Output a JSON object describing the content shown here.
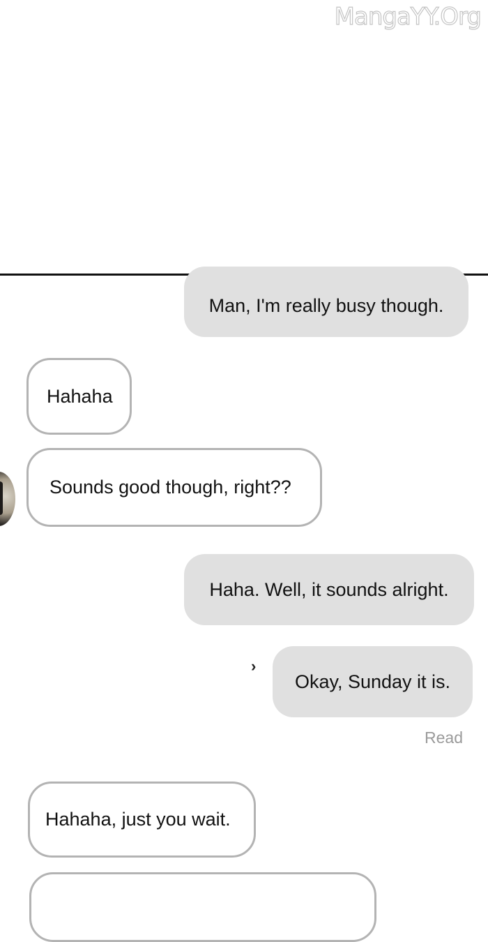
{
  "watermark": "MangaYY.Org",
  "messages": [
    {
      "side": "sent",
      "text": "Man, I'm really busy though."
    },
    {
      "side": "received",
      "text": "Hahaha"
    },
    {
      "side": "received",
      "text": "Sounds good though, right??"
    },
    {
      "side": "sent",
      "text": "Haha. Well, it sounds alright."
    },
    {
      "side": "sent",
      "text": "Okay, Sunday it is."
    },
    {
      "side": "received",
      "text": "Hahaha, just you wait."
    },
    {
      "side": "received",
      "text": ""
    }
  ],
  "read_receipt": "Read",
  "colors": {
    "sent_bubble": "#e0e0e0",
    "received_border": "#b3b3b3",
    "divider": "#111111",
    "read_text": "#9a9a9a"
  }
}
